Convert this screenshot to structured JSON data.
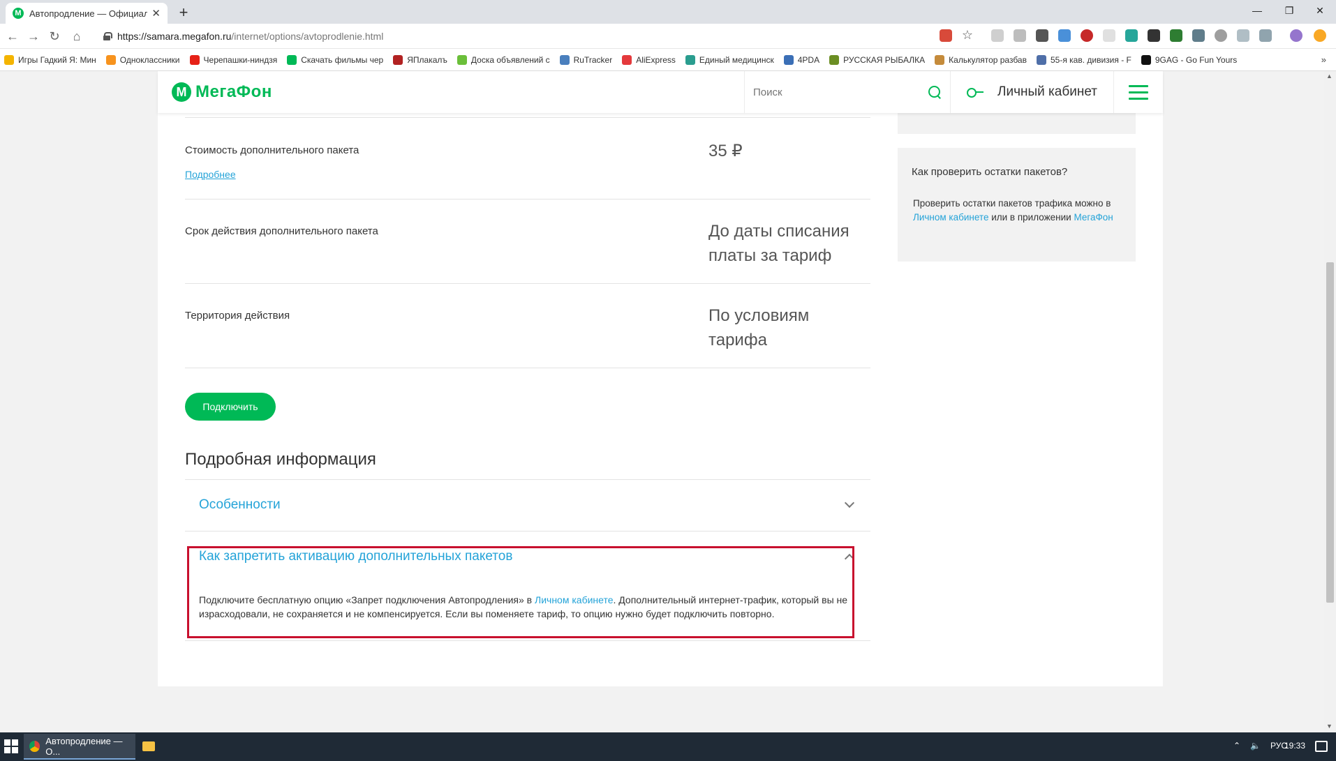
{
  "browser": {
    "tab_title": "Автопродление — Официальны",
    "tab_close": "✕",
    "new_tab": "+",
    "window_controls": [
      "—",
      "❐",
      "✕"
    ],
    "url_host": "https://samara.megafon.ru",
    "url_path": "/internet/options/avtoprodlenie.html",
    "bookmarks": [
      {
        "label": "Игры Гадкий Я: Мин",
        "color": "#f4b400"
      },
      {
        "label": "Одноклассники",
        "color": "#f7931e"
      },
      {
        "label": "Черепашки-ниндзя",
        "color": "#e62117"
      },
      {
        "label": "Скачать фильмы чер",
        "color": "#00b956"
      },
      {
        "label": "ЯПлакалъ",
        "color": "#b22222"
      },
      {
        "label": "Доска объявлений с",
        "color": "#6bbf3a"
      },
      {
        "label": "RuTracker",
        "color": "#4a7fbd"
      },
      {
        "label": "AliExpress",
        "color": "#e4393c"
      },
      {
        "label": "Единый медицинск",
        "color": "#2a9d8f"
      },
      {
        "label": "4PDA",
        "color": "#3b6fb6"
      },
      {
        "label": "РУССКАЯ РЫБАЛКА",
        "color": "#6b8e23"
      },
      {
        "label": "Калькулятор разбав",
        "color": "#c58b3b"
      },
      {
        "label": "55-я кав. дивизия - F",
        "color": "#4f6fa8"
      },
      {
        "label": "9GAG - Go Fun Yours",
        "color": "#111111"
      }
    ],
    "bookmarks_more": "»"
  },
  "header": {
    "logo_letter": "М",
    "logo_text": "МегаФон",
    "search_placeholder": "Поиск",
    "cabinet_label": "Личный кабинет"
  },
  "rows": [
    {
      "label": "Стоимость дополнительного пакета",
      "link": "Подробнее",
      "value": "35 ₽"
    },
    {
      "label": "Срок действия дополнительного пакета",
      "value": "До даты списания платы за тариф"
    },
    {
      "label": "Территория действия",
      "value": "По условиям тарифа"
    }
  ],
  "connect_button": "Подключить",
  "details": {
    "title": "Подробная информация",
    "accordion": [
      {
        "title": "Особенности"
      },
      {
        "title": "Как запретить активацию дополнительных пакетов",
        "body_before": "Подключите бесплатную опцию «Запрет подключения Автопродления» в ",
        "body_link": "Личном кабинете",
        "body_after": ". Дополнительный интернет-трафик, который вы не израсходовали, не сохраняется и не компенсируется. Если вы поменяете тариф, то опцию нужно будет подключить повторно."
      }
    ]
  },
  "sidebar": {
    "card_title": "Как проверить остатки пакетов?",
    "text_before": "Проверить остатки пакетов трафика можно в ",
    "link1": "Личном кабинете",
    "text_mid": " или в приложении ",
    "link2": "МегаФон"
  },
  "taskbar": {
    "app_label": "Автопродление — О...",
    "lang": "РУС",
    "clock": "19:33"
  },
  "colors": {
    "brand_green": "#00b956",
    "link_blue": "#24a3d8",
    "highlight_red": "#c8102e"
  }
}
